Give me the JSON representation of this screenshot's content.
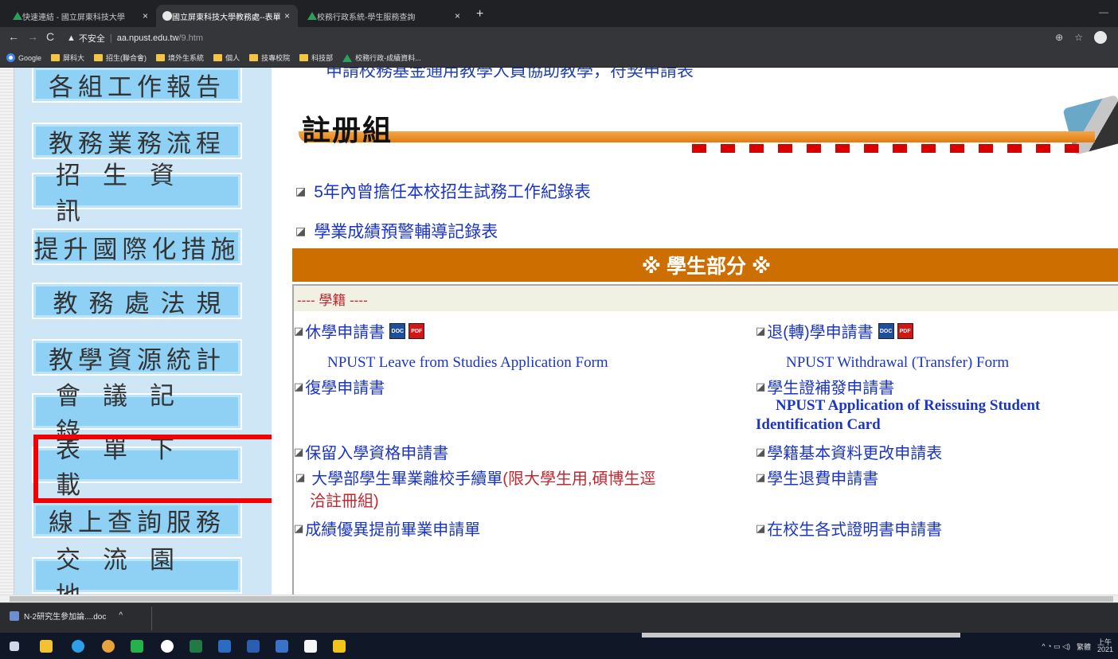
{
  "browser": {
    "tabs": [
      {
        "title": "快速連結 - 國立屏東科技大學",
        "active": false
      },
      {
        "title": "國立屏東科技大學教務處--表單",
        "active": true
      },
      {
        "title": "校務行政系統-學生服務查詢",
        "active": false
      }
    ],
    "address": {
      "security": "不安全",
      "host": "aa.npust.edu.tw",
      "path": "/9.htm"
    },
    "bookmarks": [
      "Google",
      "屏科大",
      "招生(聯合會)",
      "境外生系統",
      "個人",
      "技專校院",
      "科技部",
      "校務行政-成績資料..."
    ]
  },
  "sidebar": {
    "items": [
      {
        "label": "各組工作報告"
      },
      {
        "label": "教務業務流程"
      },
      {
        "label": "招生資訊"
      },
      {
        "label": "提升國際化措施"
      },
      {
        "label": "教務處法規"
      },
      {
        "label": "教學資源統計"
      },
      {
        "label": "會議記錄"
      },
      {
        "label": "表單下載"
      },
      {
        "label": "線上查詢服務"
      },
      {
        "label": "交流園地"
      }
    ],
    "highlighted": "表單下載"
  },
  "content": {
    "cut_text": "申請校務基金通用教學人員協助教學，符契申請表",
    "section_title": "註册組",
    "links": [
      "5年內曾擔任本校招生試務工作紀錄表",
      "學業成績預警輔導記錄表"
    ],
    "banner": "※ 學生部分 ※",
    "category": "---- 學籍 ----",
    "forms": [
      {
        "label": "休學申請書",
        "eng": "NPUST Leave from Studies Application Form",
        "has_icons": true
      },
      {
        "label": "退(轉)學申請書",
        "eng": "NPUST Withdrawal (Transfer) Form",
        "has_icons": true
      },
      {
        "label": "復學申請書"
      },
      {
        "label": "學生證補發申請書",
        "eng_line1": "NPUST Application of Reissuing Student",
        "eng_line2": "Identification Card"
      },
      {
        "label": "保留入學資格申請書"
      },
      {
        "label": "學籍基本資料更改申請表"
      },
      {
        "label": "大學部學生畢業離校手續單",
        "note_line1": "(限大學生用,碩博生逕",
        "note_line2": "洽註冊組)"
      },
      {
        "label": "學生退費申請書"
      },
      {
        "label": "成績優異提前畢業申請單"
      },
      {
        "label": "在校生各式證明書申請書"
      }
    ],
    "icon_labels": {
      "doc": "DOC",
      "pdf": "PDF"
    }
  },
  "download": {
    "file": "N-2研究生參加論....doc"
  },
  "taskbar": {
    "time": "上午",
    "year": "2021",
    "lang": "繁體"
  }
}
